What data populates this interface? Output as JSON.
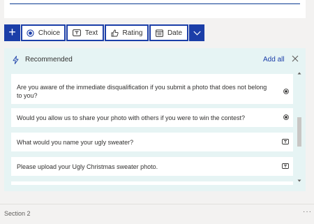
{
  "toolbar": {
    "add_label": "+",
    "choice_label": "Choice",
    "text_label": "Text",
    "rating_label": "Rating",
    "date_label": "Date"
  },
  "recommended": {
    "title": "Recommended",
    "add_all_label": "Add all",
    "questions": [
      {
        "text": "Are you aware of the immediate disqualification if you submit a photo that does not belong to you?",
        "type_icon": "radio-icon"
      },
      {
        "text": "Would you allow us to share your photo with others if you were to win the contest?",
        "type_icon": "radio-icon"
      },
      {
        "text": "What would you name your ugly sweater?",
        "type_icon": "text-icon"
      },
      {
        "text": "Please upload your Ugly Christmas sweater photo.",
        "type_icon": "text-icon"
      }
    ]
  },
  "footer": {
    "section_label": "Section 2",
    "more_label": "···"
  },
  "colors": {
    "accent": "#1b3ea8",
    "panel_bg": "#e6f4f4",
    "page_bg": "#f3f2f1"
  }
}
